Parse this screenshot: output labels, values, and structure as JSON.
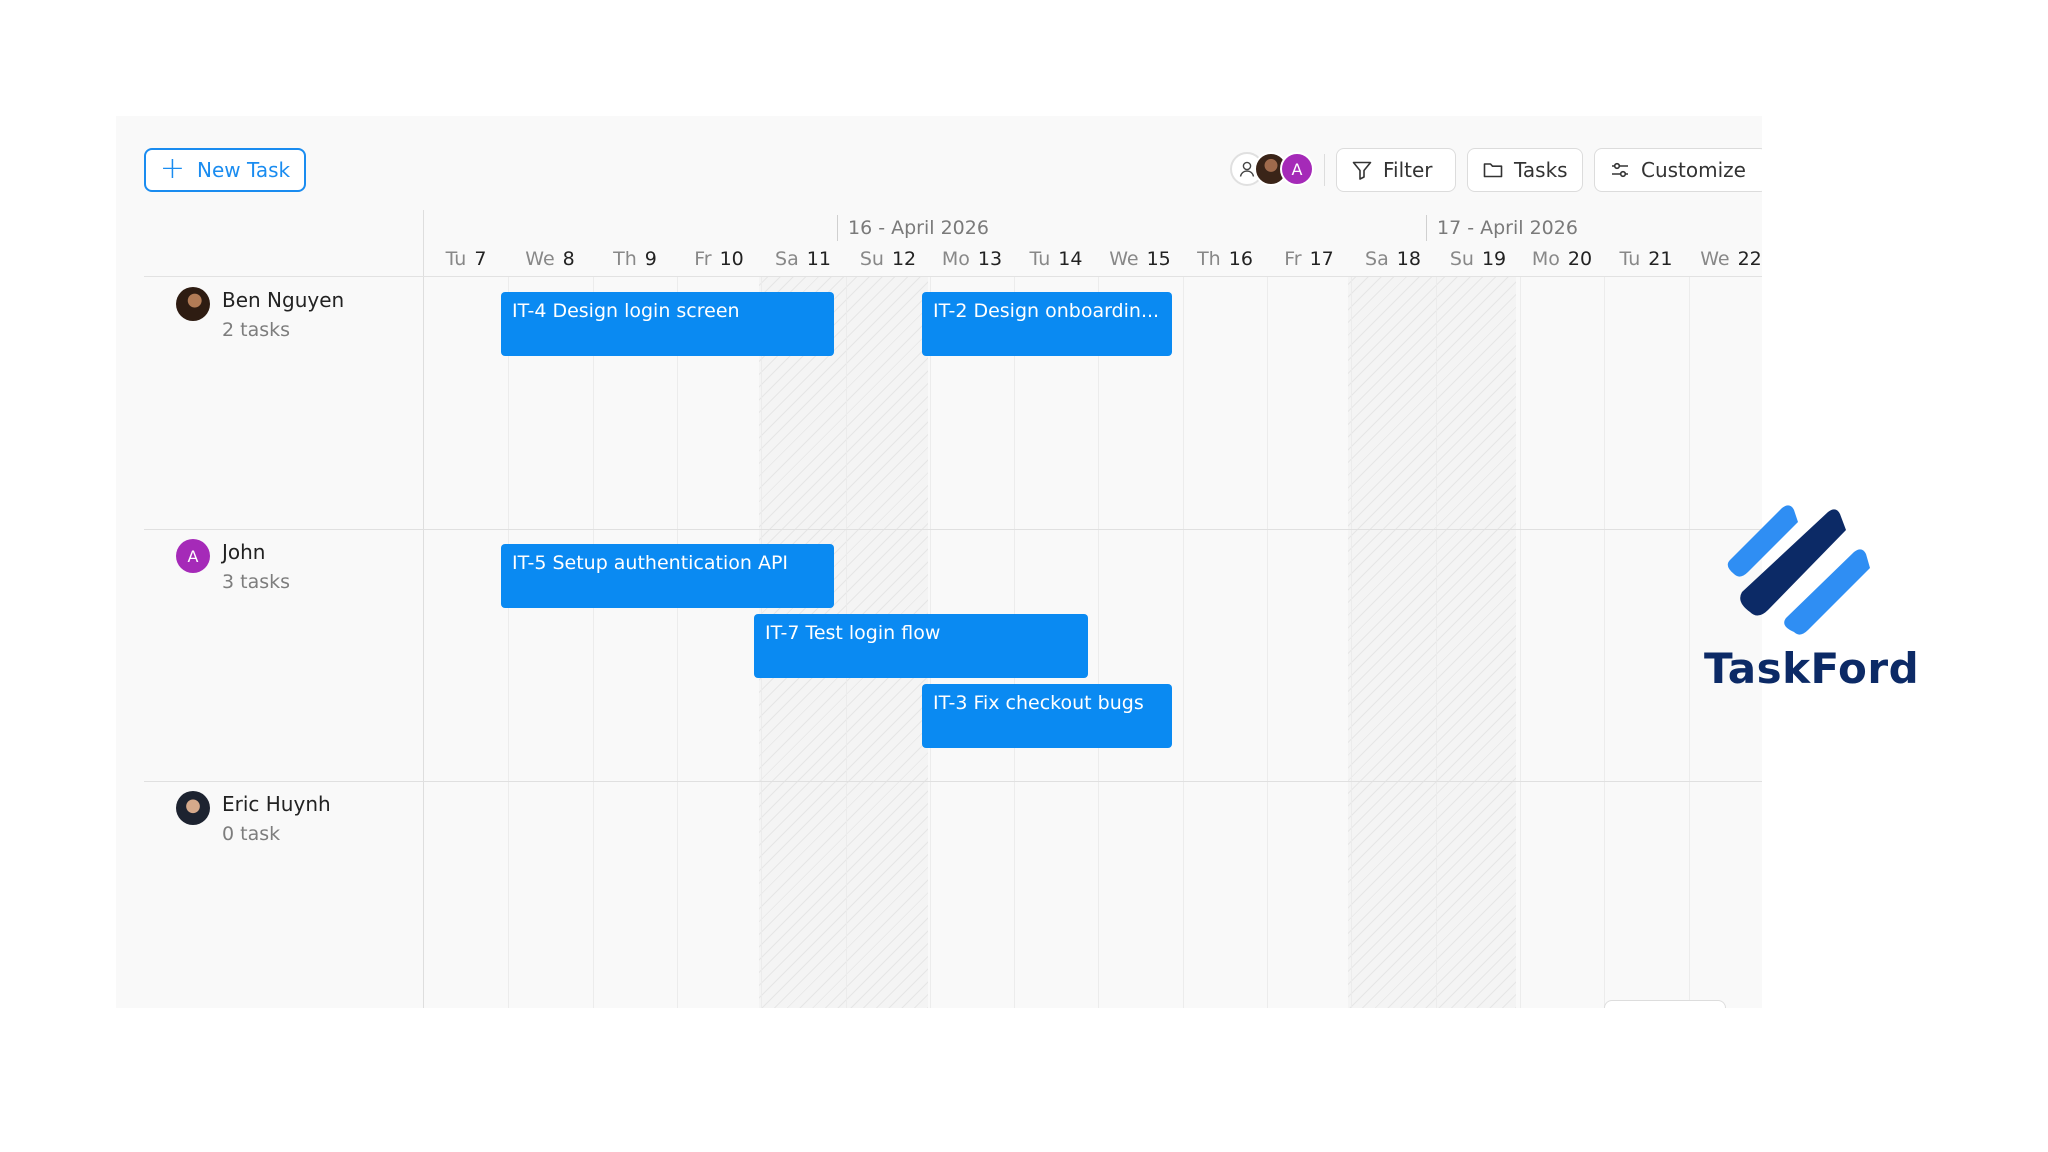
{
  "toolbar": {
    "new_task_label": "New Task",
    "assignee_avatar_letter": "A",
    "filter_label": "Filter",
    "tasks_label": "Tasks",
    "customize_label": "Customize"
  },
  "timeline": {
    "months": [
      "16 - April 2026",
      "17 - April 2026"
    ],
    "days": [
      {
        "dow": "Tu",
        "num": "7"
      },
      {
        "dow": "We",
        "num": "8"
      },
      {
        "dow": "Th",
        "num": "9"
      },
      {
        "dow": "Fr",
        "num": "10"
      },
      {
        "dow": "Sa",
        "num": "11"
      },
      {
        "dow": "Su",
        "num": "12"
      },
      {
        "dow": "Mo",
        "num": "13"
      },
      {
        "dow": "Tu",
        "num": "14"
      },
      {
        "dow": "We",
        "num": "15"
      },
      {
        "dow": "Th",
        "num": "16"
      },
      {
        "dow": "Fr",
        "num": "17"
      },
      {
        "dow": "Sa",
        "num": "18"
      },
      {
        "dow": "Su",
        "num": "19"
      },
      {
        "dow": "Mo",
        "num": "20"
      },
      {
        "dow": "Tu",
        "num": "21"
      },
      {
        "dow": "We",
        "num": "22"
      }
    ]
  },
  "people": [
    {
      "name": "Ben Nguyen",
      "count": "2 tasks",
      "avatar_letter": ""
    },
    {
      "name": "John",
      "count": "3 tasks",
      "avatar_letter": "A"
    },
    {
      "name": "Eric Huynh",
      "count": "0 task",
      "avatar_letter": ""
    }
  ],
  "tasks": [
    {
      "label": "IT-4 Design login screen",
      "assignee": "Ben Nguyen",
      "start": "We 8",
      "end": "Sa 11"
    },
    {
      "label": "IT-2 Design onboardin...",
      "assignee": "Ben Nguyen",
      "start": "Mo 13",
      "end": "We 15"
    },
    {
      "label": "IT-5 Setup authentication API",
      "assignee": "John",
      "start": "We 8",
      "end": "Sa 11"
    },
    {
      "label": "IT-7 Test login flow",
      "assignee": "John",
      "start": "Sa 11",
      "end": "Tu 14"
    },
    {
      "label": "IT-3 Fix checkout bugs",
      "assignee": "John",
      "start": "Mo 13",
      "end": "We 15"
    }
  ],
  "brand": {
    "name": "TaskFord",
    "accent": "#0a8af2",
    "logo_dark": "#0c2a66",
    "logo_light": "#2f8ef3"
  }
}
